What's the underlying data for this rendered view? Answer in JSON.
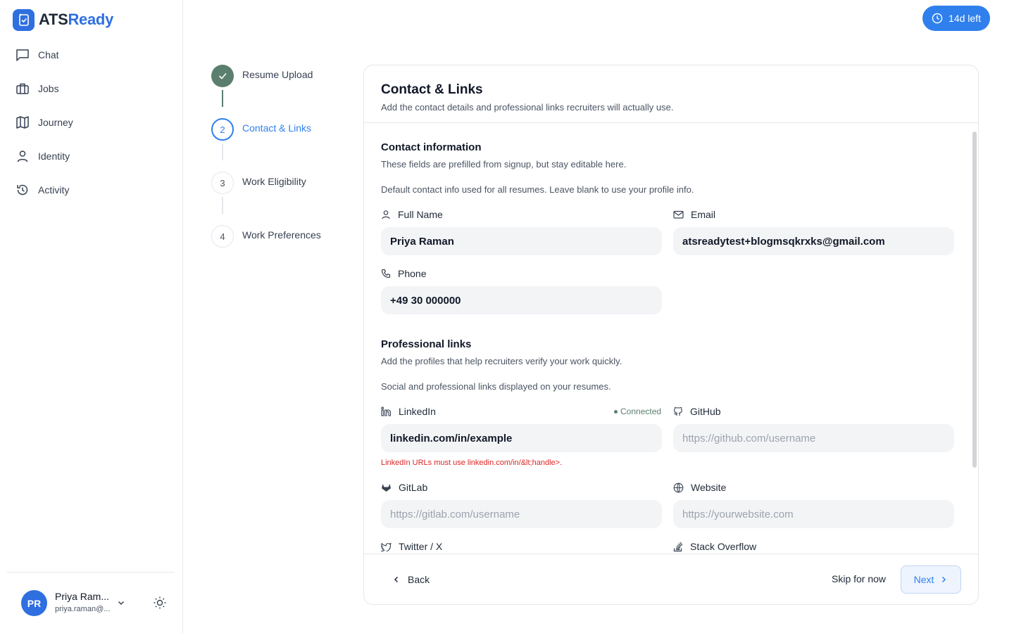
{
  "brand": {
    "name_part1": "ATS",
    "name_part2": "Ready",
    "accent": "#2f80ed"
  },
  "trial": {
    "label": "14d left"
  },
  "sidebar": {
    "items": [
      {
        "label": "Chat",
        "icon": "chat-icon"
      },
      {
        "label": "Jobs",
        "icon": "briefcase-icon"
      },
      {
        "label": "Journey",
        "icon": "map-icon"
      },
      {
        "label": "Identity",
        "icon": "user-icon"
      },
      {
        "label": "Activity",
        "icon": "history-icon"
      }
    ],
    "user": {
      "initials": "PR",
      "name": "Priya Ram...",
      "email": "priya.raman@..."
    }
  },
  "stepper": {
    "steps": [
      {
        "number": "1",
        "label": "Resume Upload",
        "status": "done"
      },
      {
        "number": "2",
        "label": "Contact & Links",
        "status": "active"
      },
      {
        "number": "3",
        "label": "Work Eligibility",
        "status": "todo"
      },
      {
        "number": "4",
        "label": "Work Preferences",
        "status": "todo"
      }
    ]
  },
  "card": {
    "title": "Contact & Links",
    "subtitle": "Add the contact details and professional links recruiters will actually use."
  },
  "contact": {
    "title": "Contact information",
    "desc": "These fields are prefilled from signup, but stay editable here.",
    "note": "Default contact info used for all resumes. Leave blank to use your profile info.",
    "full_name": {
      "label": "Full Name",
      "value": "Priya Raman"
    },
    "email": {
      "label": "Email",
      "value": "atsreadytest+blogmsqkrxks@gmail.com"
    },
    "phone": {
      "label": "Phone",
      "value": "+49 30 000000"
    }
  },
  "links": {
    "title": "Professional links",
    "desc": "Add the profiles that help recruiters verify your work quickly.",
    "note": "Social and professional links displayed on your resumes.",
    "linkedin": {
      "label": "LinkedIn",
      "value": "linkedin.com/in/example",
      "status": "Connected",
      "error": "LinkedIn URLs must use linkedin.com/in/&lt;handle>."
    },
    "github": {
      "label": "GitHub",
      "placeholder": "https://github.com/username"
    },
    "gitlab": {
      "label": "GitLab",
      "placeholder": "https://gitlab.com/username"
    },
    "website": {
      "label": "Website",
      "placeholder": "https://yourwebsite.com"
    },
    "twitter": {
      "label": "Twitter / X"
    },
    "stackoverflow": {
      "label": "Stack Overflow"
    }
  },
  "footer": {
    "back": "Back",
    "skip": "Skip for now",
    "next": "Next"
  }
}
